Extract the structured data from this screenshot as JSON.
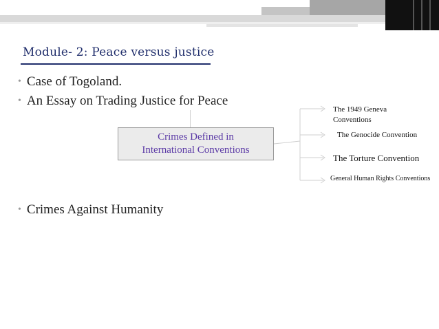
{
  "title": "Module- 2: Peace versus justice",
  "bullets": [
    "Case of Togoland.",
    "An Essay on Trading Justice for Peace",
    "Crimes Against Humanity"
  ],
  "diagram": {
    "center": "Crimes Defined in International Conventions",
    "children": [
      "The 1949 Geneva Conventions",
      "The Genocide Convention",
      "The Torture Convention",
      "General Human Rights Conventions"
    ]
  },
  "colors": {
    "title": "#1f2d6b",
    "center_text": "#5b3aa6",
    "center_fill": "#ebebeb"
  }
}
